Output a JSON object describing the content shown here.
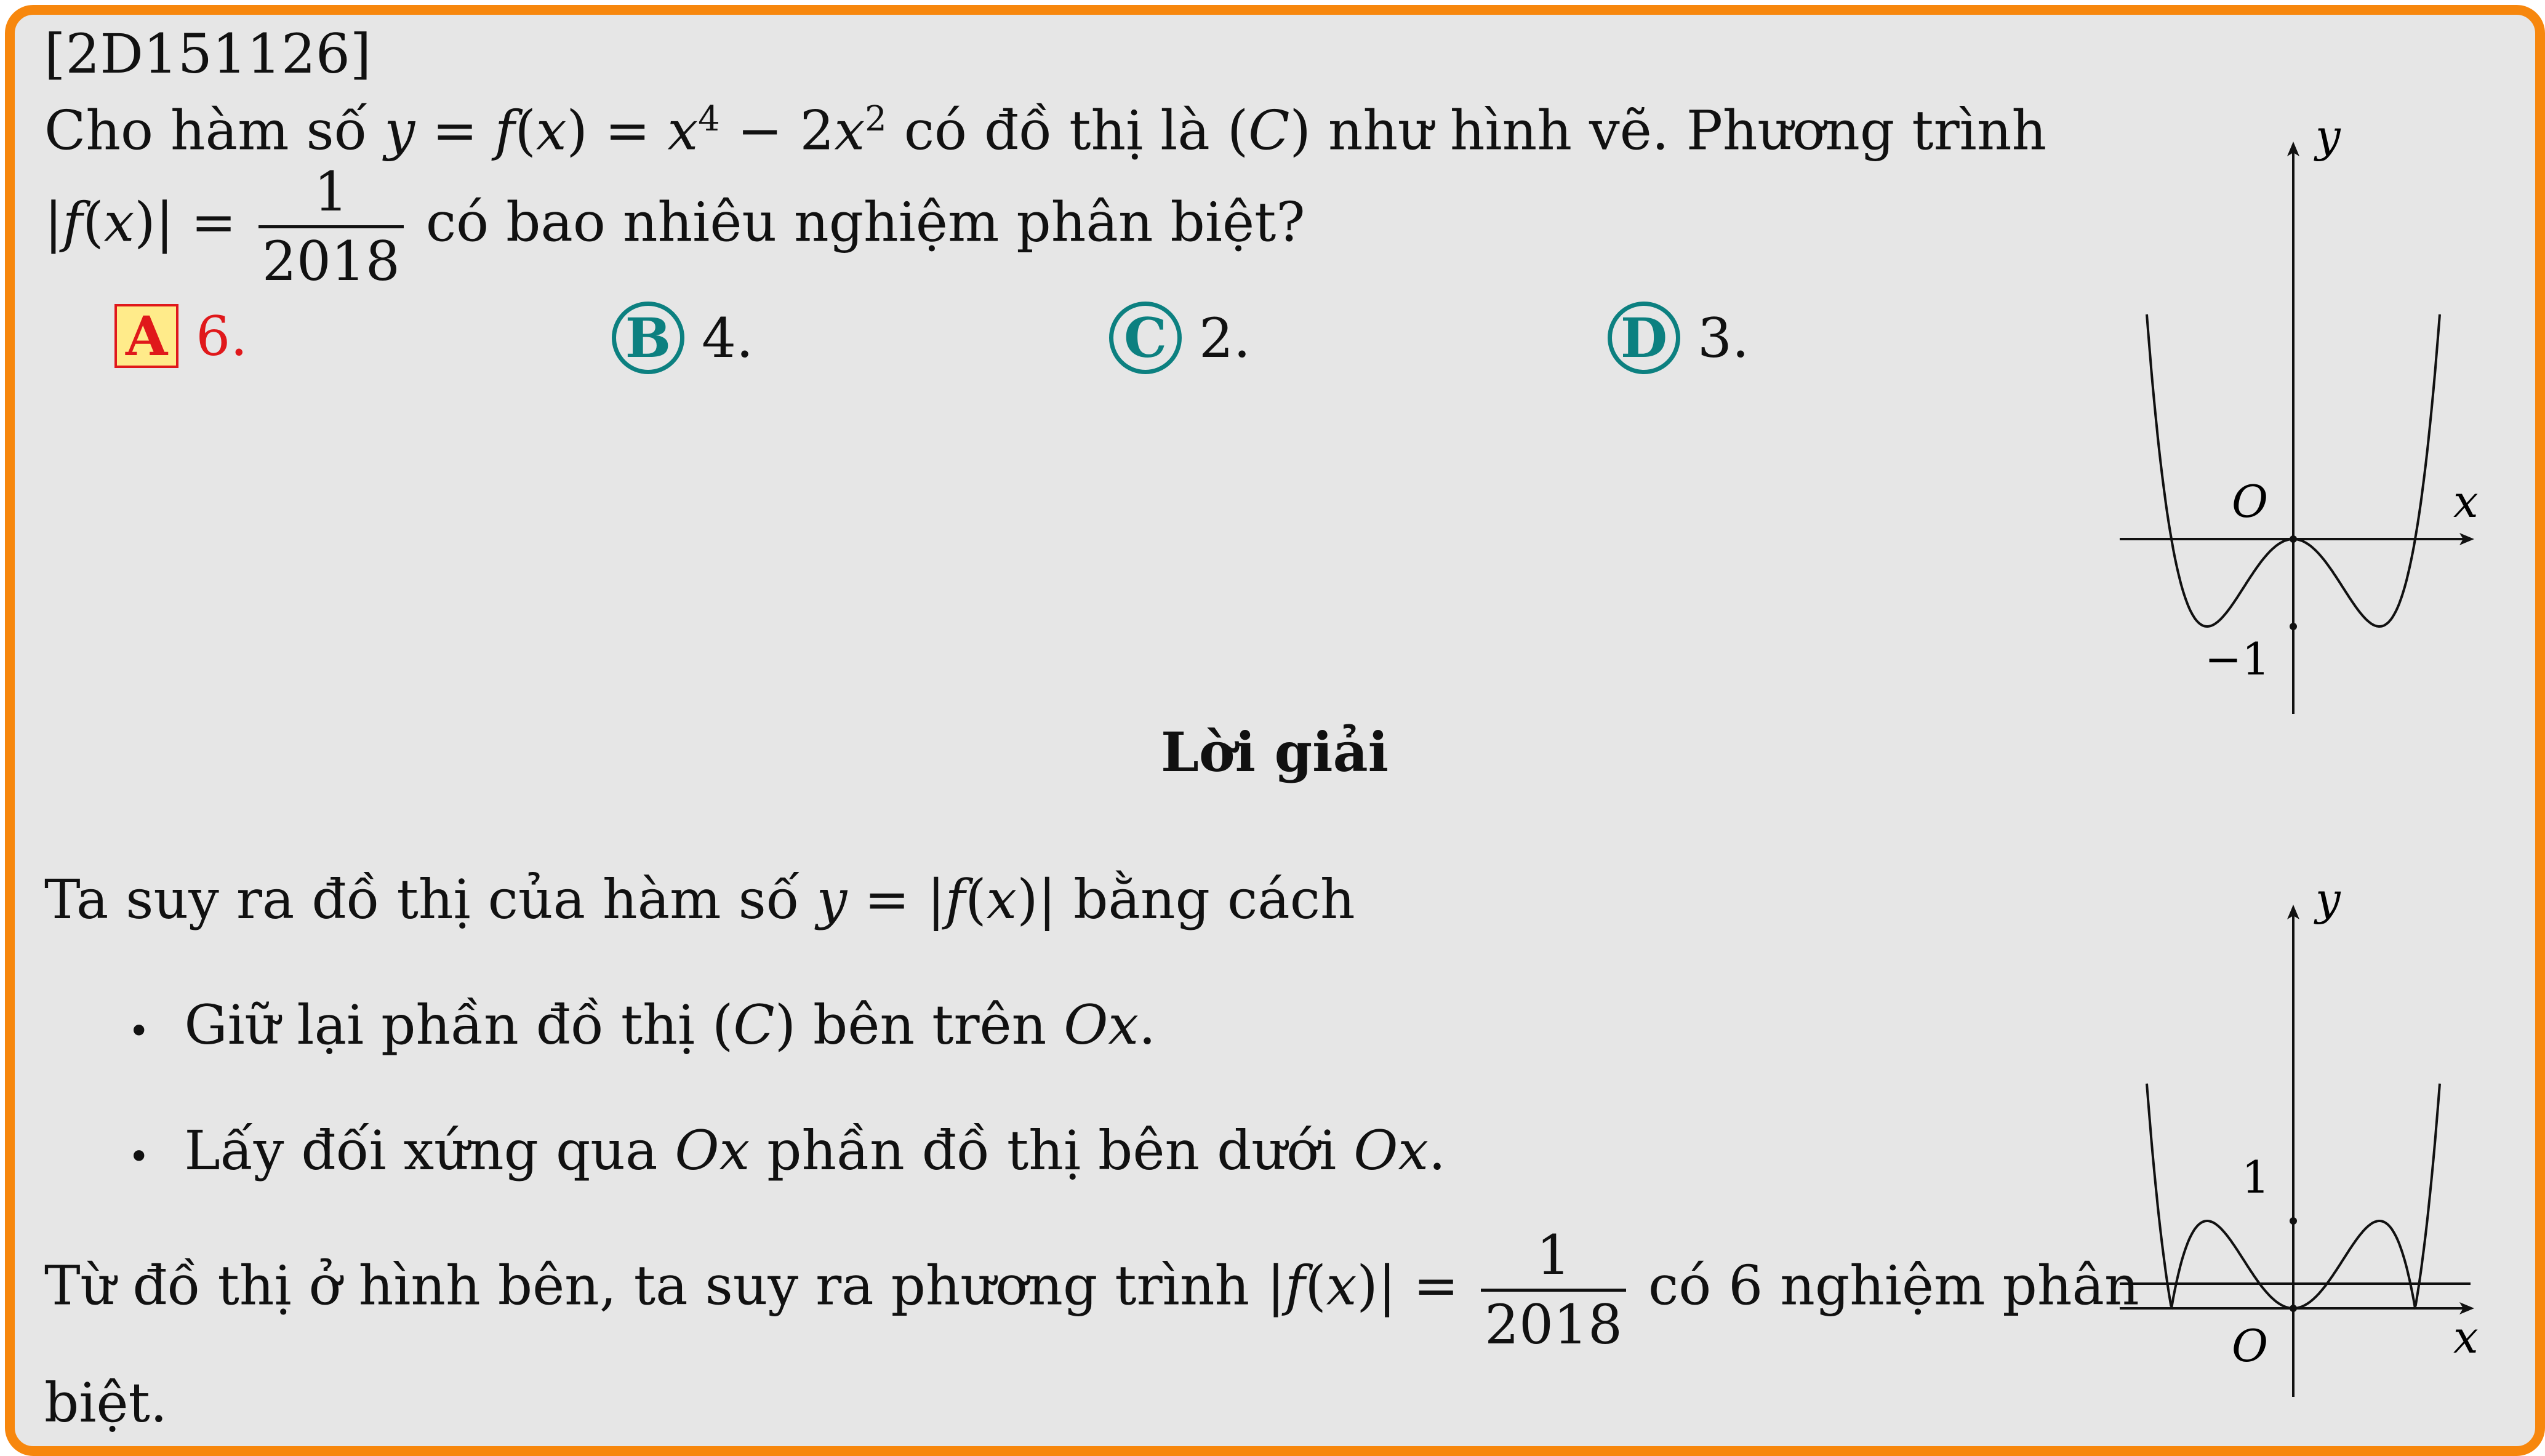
{
  "problem": {
    "id": "[2D151126]",
    "line1_a": "Cho hàm số ",
    "y": "y",
    "eq": " = ",
    "f": "f",
    "x": "x",
    "lpar": "(",
    "rpar": ")",
    "x4": "x",
    "exp4": "4",
    "minus": " − 2",
    "x2": "x",
    "exp2": "2",
    "line1_b": " có đồ thị là ",
    "C": "C",
    "line1_c": " như hình vẽ. Phương trình",
    "abs_open": "|",
    "abs_close": "|",
    "frac_num": "1",
    "frac_den": "2018",
    "line2_b": " có bao nhiêu nghiệm phân biệt?"
  },
  "options": [
    {
      "letter": "A",
      "text": "6.",
      "correct": true
    },
    {
      "letter": "B",
      "text": "4.",
      "correct": false
    },
    {
      "letter": "C",
      "text": "2.",
      "correct": false
    },
    {
      "letter": "D",
      "text": "3.",
      "correct": false
    }
  ],
  "solution": {
    "heading": "Lời giải",
    "intro_a": "Ta suy ra đồ thị của hàm số ",
    "intro_b": " bằng cách",
    "bullet_symbol": "•",
    "bullet1_a": "Giữ lại phần đồ thị ",
    "bullet1_b": " bên trên ",
    "Ox": "Ox",
    "bullet2_a": "Lấy đối xứng qua ",
    "bullet2_b": " phần đồ thị bên dưới ",
    "period": ".",
    "concl_a": "Từ đồ thị ở hình bên, ta suy ra phương trình ",
    "concl_b": " có 6 nghiệm phân",
    "concl_c": "biệt."
  },
  "graph1": {
    "label_y": "y",
    "label_x": "x",
    "label_O": "O",
    "label_m1": "−1",
    "function": "x^4 - 2x^2",
    "x_range": [
      -2.0,
      2.0
    ]
  },
  "graph2": {
    "label_y": "y",
    "label_x": "x",
    "label_O": "O",
    "label_1": "1",
    "function": "|x^4 - 2x^2|",
    "line": "y = 1/2018"
  },
  "colors": {
    "frame": "#f7870d",
    "background": "#e6e6e6",
    "correct": "#e0181b",
    "option_circle": "#0c8080",
    "highlight": "#ffeb8a"
  }
}
